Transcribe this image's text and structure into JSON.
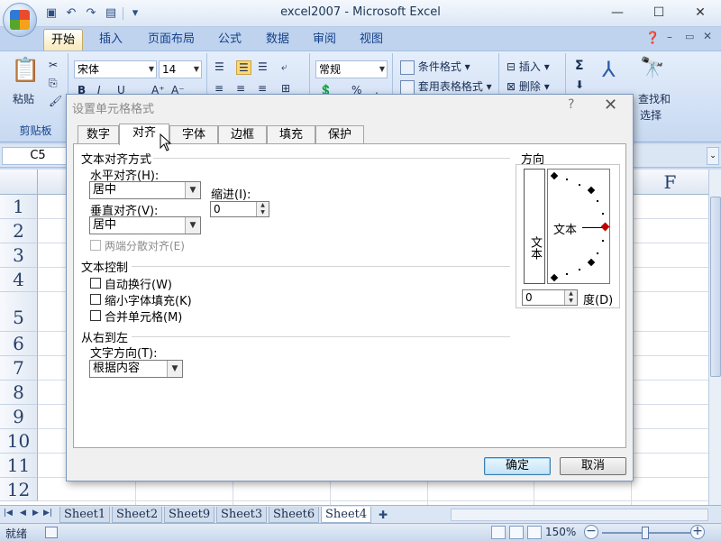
{
  "window": {
    "title": "excel2007 - Microsoft Excel"
  },
  "ribbon_tabs": [
    "开始",
    "插入",
    "页面布局",
    "公式",
    "数据",
    "审阅",
    "视图"
  ],
  "ribbon": {
    "clipboard": {
      "paste_label": "粘贴",
      "group_label": "剪贴板"
    },
    "font": {
      "name": "宋体",
      "size": "14"
    },
    "number": {
      "format": "常规"
    },
    "styles": {
      "conditional": "条件格式",
      "table": "套用表格格式"
    },
    "cells": {
      "insert": "插入",
      "delete": "删除"
    },
    "editing": {
      "sigma": "Σ",
      "find_line1": "查找和",
      "find_line2": "选择"
    }
  },
  "formula_bar": {
    "name_box": "C5"
  },
  "grid": {
    "column_label": "F",
    "rows": [
      "1",
      "2",
      "3",
      "4",
      "5",
      "6",
      "7",
      "8",
      "9",
      "10",
      "11",
      "12"
    ]
  },
  "sheet_tabs": [
    "Sheet1",
    "Sheet2",
    "Sheet9",
    "Sheet3",
    "Sheet6",
    "Sheet4"
  ],
  "status": {
    "ready": "就绪",
    "zoom": "150%"
  },
  "dialog": {
    "title": "设置单元格格式",
    "help": "?",
    "close": "✕",
    "tabs": [
      "数字",
      "对齐",
      "字体",
      "边框",
      "填充",
      "保护"
    ],
    "text_alignment": {
      "heading": "文本对齐方式",
      "horizontal_label": "水平对齐(H):",
      "horizontal_value": "居中",
      "vertical_label": "垂直对齐(V):",
      "vertical_value": "居中",
      "indent_label": "缩进(I):",
      "indent_value": "0",
      "justify_distributed": "两端分散对齐(E)"
    },
    "text_control": {
      "heading": "文本控制",
      "wrap_text": "自动换行(W)",
      "shrink_to_fit": "缩小字体填充(K)",
      "merge_cells": "合并单元格(M)"
    },
    "rtl": {
      "heading": "从右到左",
      "direction_label": "文字方向(T):",
      "direction_value": "根据内容"
    },
    "orientation": {
      "heading": "方向",
      "vertical_text": "文本",
      "dial_text": "文本",
      "degrees_value": "0",
      "degrees_label": "度(D)"
    },
    "ok": "确定",
    "cancel": "取消"
  }
}
